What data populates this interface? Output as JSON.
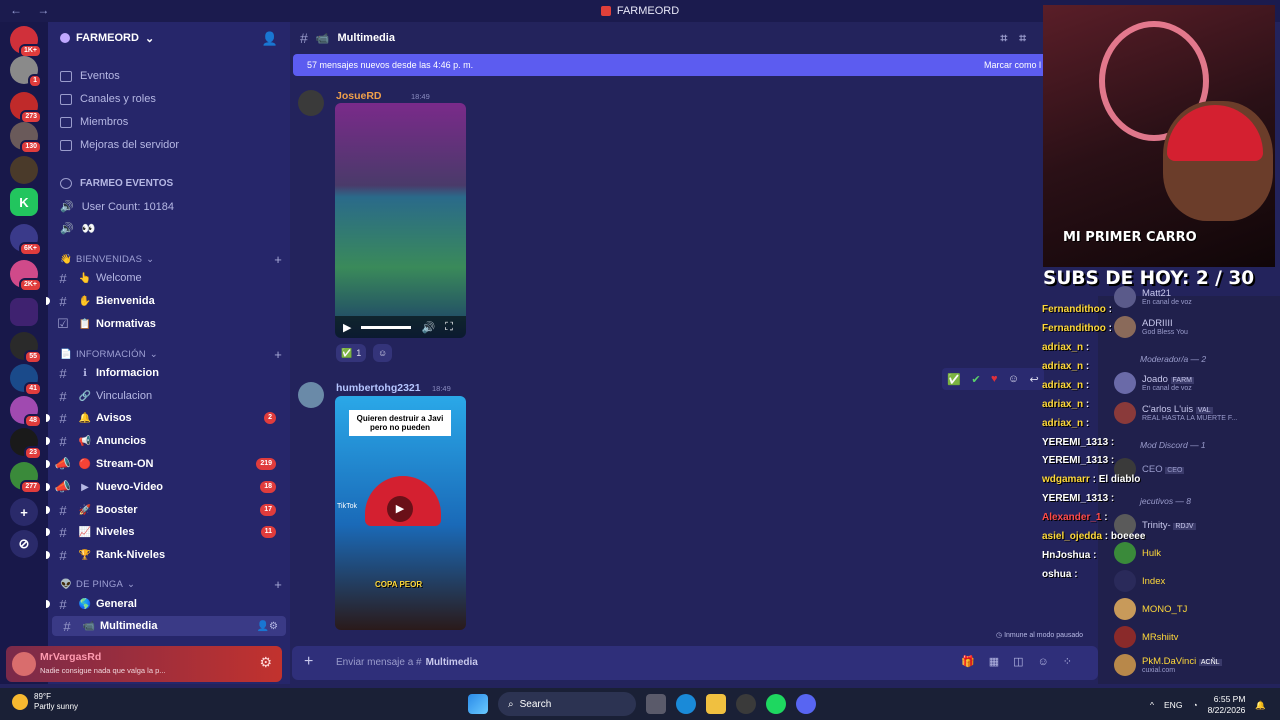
{
  "window": {
    "title": "FARMEORD"
  },
  "server": {
    "name": "FARMEORD",
    "rail_badges": [
      "1K+",
      "1",
      "273",
      "130",
      "6K+",
      "2K+",
      "55",
      "41",
      "48",
      "23",
      "277"
    ],
    "menu": [
      "Eventos",
      "Canales y roles",
      "Miembros",
      "Mejoras del servidor"
    ],
    "special": [
      {
        "label": "FARMEO EVENTOS"
      },
      {
        "label": "User Count: 10184"
      }
    ],
    "categories": [
      {
        "name": "BIENVENIDAS",
        "channels": [
          {
            "name": "Welcome",
            "emoji": "👆",
            "bold": false
          },
          {
            "name": "Bienvenida",
            "emoji": "✋",
            "bold": true
          },
          {
            "name": "Normativas",
            "emoji": "📋",
            "bold": true
          }
        ]
      },
      {
        "name": "INFORMACIÓN",
        "channels": [
          {
            "name": "Informacion",
            "emoji": "ℹ",
            "bold": true,
            "count": ""
          },
          {
            "name": "Vinculacion",
            "emoji": "🔗",
            "bold": false,
            "count": ""
          },
          {
            "name": "Avisos",
            "emoji": "🔔",
            "bold": true,
            "count": "2"
          },
          {
            "name": "Anuncios",
            "emoji": "📢",
            "bold": true,
            "count": ""
          },
          {
            "name": "Stream-ON",
            "emoji": "🔴",
            "bold": true,
            "count": "219"
          },
          {
            "name": "Nuevo-Video",
            "emoji": "▶",
            "bold": true,
            "count": "18"
          },
          {
            "name": "Booster",
            "emoji": "🚀",
            "bold": true,
            "count": "17"
          },
          {
            "name": "Niveles",
            "emoji": "📈",
            "bold": true,
            "count": "11"
          },
          {
            "name": "Rank-Niveles",
            "emoji": "🏆",
            "bold": true,
            "count": ""
          }
        ]
      },
      {
        "name": "DE PINGA",
        "channels": [
          {
            "name": "General",
            "emoji": "🌎",
            "bold": true
          },
          {
            "name": "Multimedia",
            "emoji": "📹",
            "bold": true
          }
        ]
      }
    ]
  },
  "user": {
    "name": "MrVargasRd",
    "status": "Nadie consigue nada que valga la p..."
  },
  "chat": {
    "channel": "Multimedia",
    "new_messages": "57 mensajes nuevos desde las 4:46 p. m.",
    "mark_read": "Marcar como l",
    "messages": [
      {
        "author": "JosueRD",
        "time": "18:49",
        "author_color": "#f0a04a",
        "reaction_count": "1"
      },
      {
        "author": "humbertohg2321",
        "time": "18:49",
        "author_color": "#b6c6ff",
        "card_text": "Quieren destruir a Javi pero no pueden",
        "overlay": "COPA PEOR",
        "tiktok": "TikTok"
      }
    ],
    "composer_placeholder": "Enviar mensaje a #",
    "composer_channel": "Multimedia",
    "paused_note": "Inmune al modo pausado"
  },
  "stream": {
    "banner": "MI PRIMER CARRO",
    "subs": "SUBS DE HOY: 2 / 30",
    "chat": [
      {
        "user": "Fernandithoo",
        "msg": "",
        "color": "#ffd93a"
      },
      {
        "user": "Fernandithoo",
        "msg": "",
        "color": "#ffd93a"
      },
      {
        "user": "adriax_n",
        "msg": "",
        "color": "#ffd93a"
      },
      {
        "user": "adriax_n",
        "msg": "",
        "color": "#ffd93a"
      },
      {
        "user": "adriax_n",
        "msg": "",
        "color": "#ffd93a"
      },
      {
        "user": "adriax_n",
        "msg": "",
        "color": "#ffd93a"
      },
      {
        "user": "adriax_n",
        "msg": "",
        "color": "#ffd93a"
      },
      {
        "user": "YEREMI_1313",
        "msg": "",
        "color": "#ffffff"
      },
      {
        "user": "YEREMI_1313",
        "msg": "",
        "color": "#ffffff"
      },
      {
        "user": "wdgamarr",
        "msg": "El diablo",
        "color": "#ffd93a"
      },
      {
        "user": "YEREMI_1313",
        "msg": "",
        "color": "#ffffff"
      },
      {
        "user": "Alexander_1",
        "msg": "",
        "color": "#ff4a4a"
      },
      {
        "user": "asiel_ojedda",
        "msg": "boeeee",
        "color": "#ffd93a"
      },
      {
        "user": "HnJoshua",
        "msg": "",
        "color": "#ffffff"
      },
      {
        "user": "oshua",
        "msg": "",
        "color": "#ffffff"
      }
    ],
    "members": [
      {
        "name": "Matt21",
        "sub": "En canal de voz",
        "color": "#c8c8ec"
      },
      {
        "name": "ADRIIII",
        "sub": "God Bless You",
        "color": "#c8c8ec"
      },
      {
        "name": "Joado",
        "tag": "FARM",
        "sub": "En canal de voz",
        "color": "#c8c8ec"
      },
      {
        "name": "C'arlos L'uis",
        "tag": "VAL",
        "sub": "REAL HASTA LA MUERTE F...",
        "color": "#c8c8ec"
      },
      {
        "name": "CEO",
        "tag": "CEO",
        "color": "#9a9ccc"
      },
      {
        "name": "Trinity-",
        "tag": "RDJV",
        "color": "#c8c8ec"
      },
      {
        "name": "Hulk",
        "color": "#ffd93a"
      },
      {
        "name": "Index",
        "color": "#ffd93a"
      },
      {
        "name": "MONO_TJ",
        "color": "#ffd93a"
      },
      {
        "name": "MRshiitv",
        "color": "#ffd93a"
      },
      {
        "name": "PkM.DaVinci",
        "tag": "ACÑL",
        "sub": "cuxial.com",
        "color": "#ffd93a"
      }
    ],
    "groups": [
      "Moderador/a — 2",
      "Mod Discord — 1",
      "jecutivos — 8"
    ]
  },
  "taskbar": {
    "weather_temp": "89°F",
    "weather_desc": "Partly sunny",
    "search": "Search",
    "lang": "ENG",
    "time": "6:55 PM",
    "date": "8/22/2026"
  }
}
